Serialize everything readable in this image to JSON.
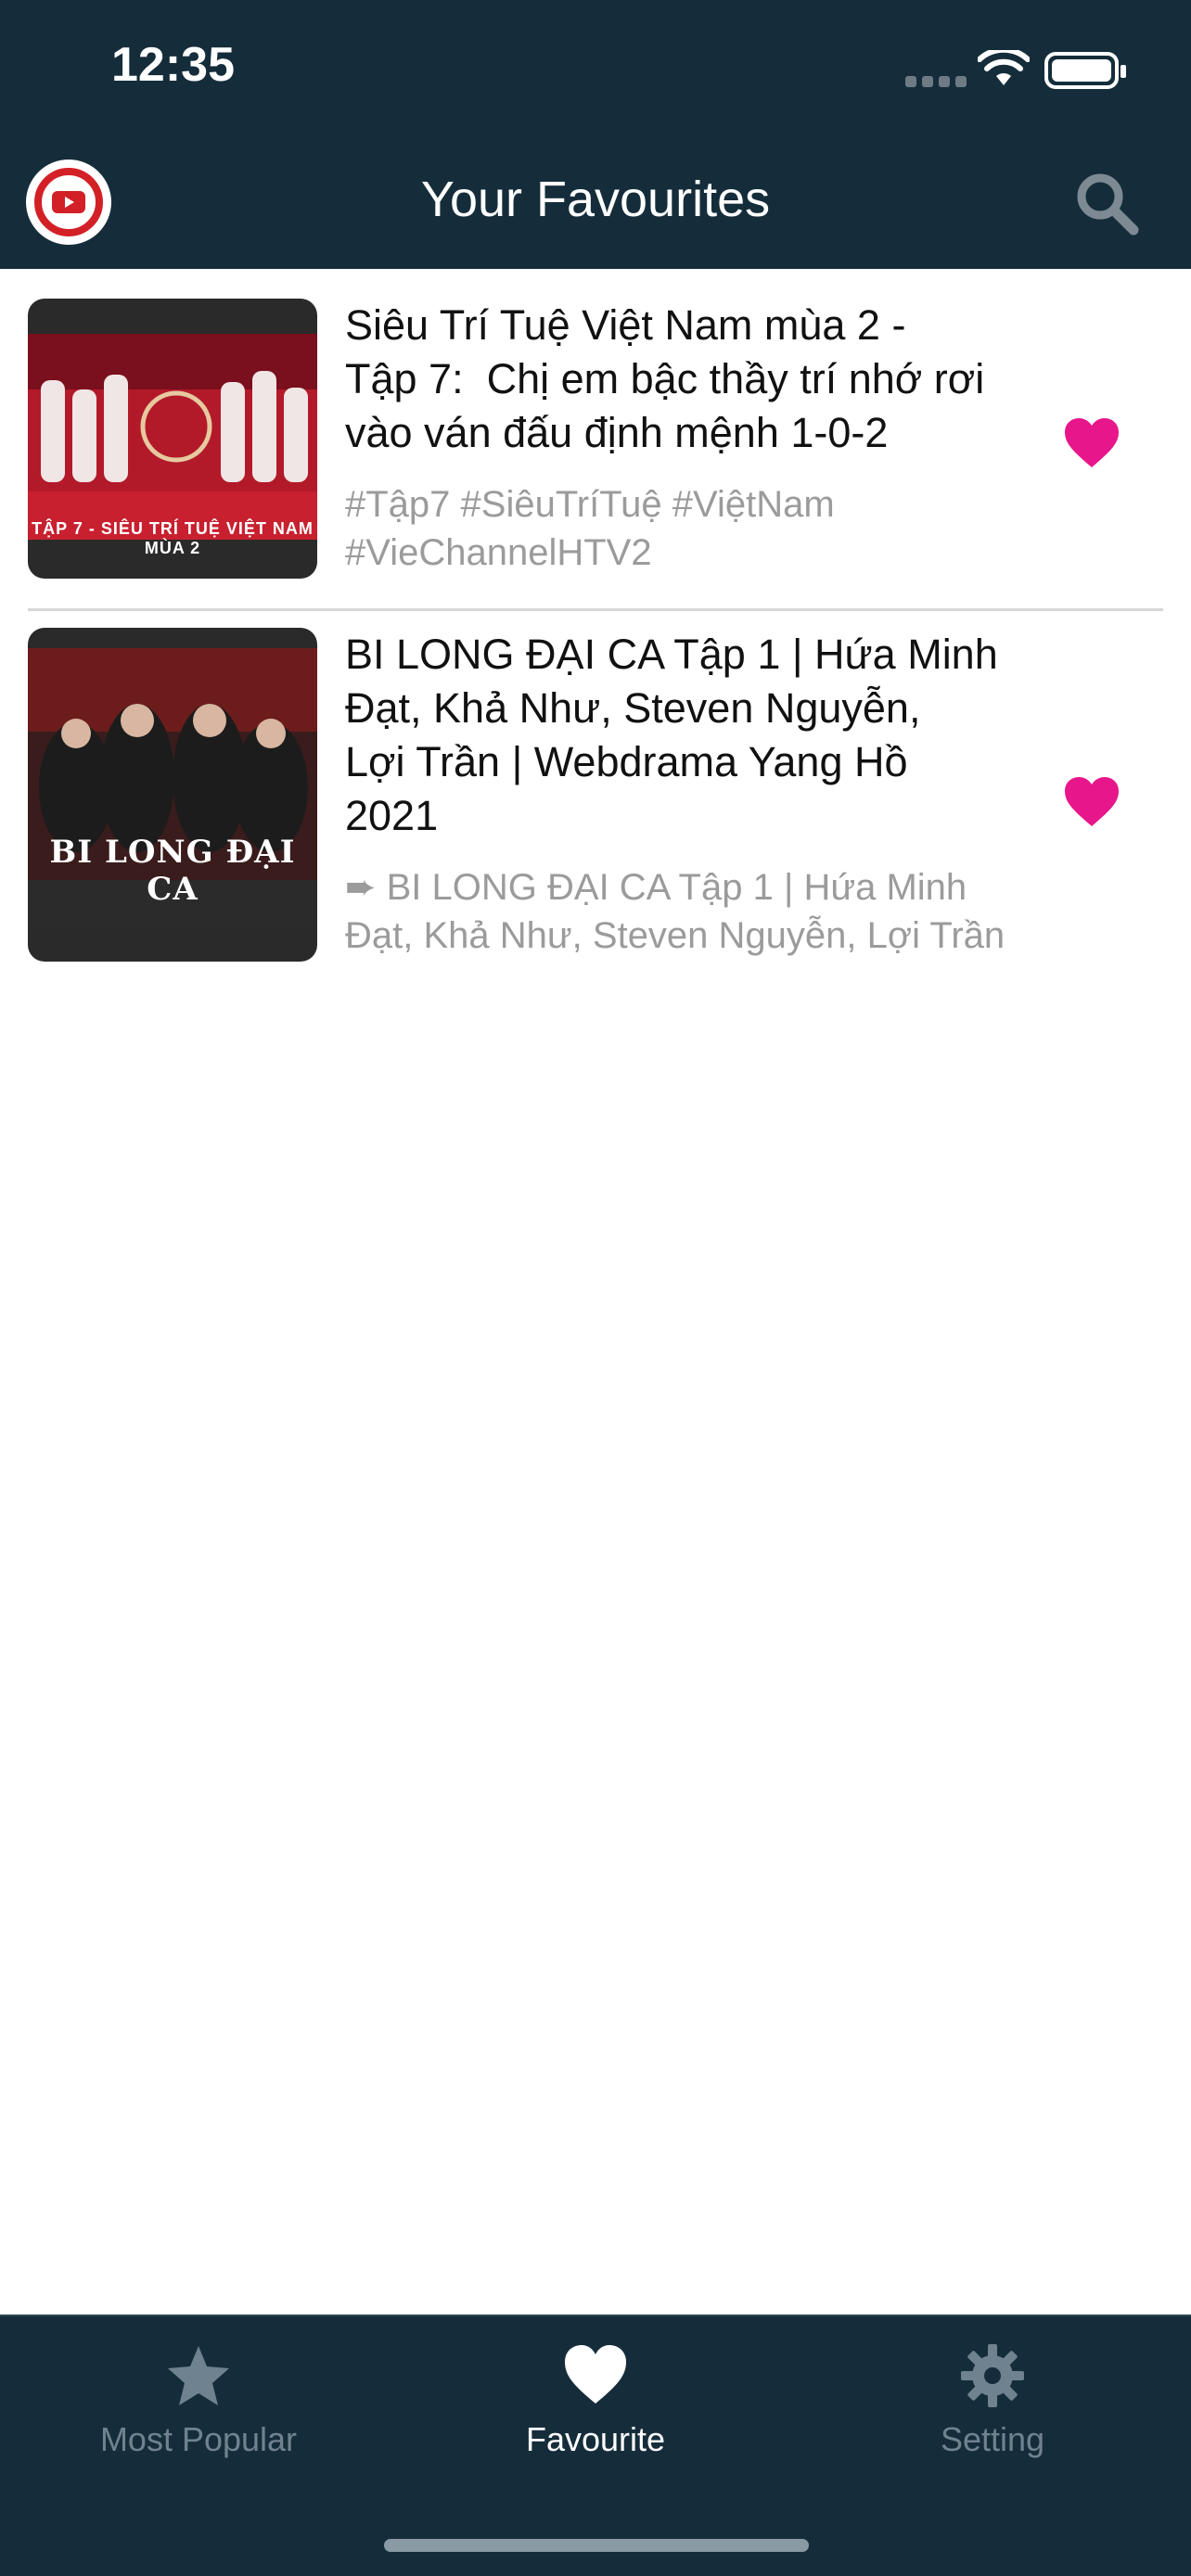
{
  "status": {
    "time": "12:35"
  },
  "header": {
    "title": "Your Favourites"
  },
  "colors": {
    "bar": "#152d3b",
    "accent": "#e8168b",
    "muted": "#9b9b9b"
  },
  "items": [
    {
      "title": "Siêu Trí Tuệ Việt Nam mùa 2 -\nTập 7:  Chị em bậc thầy trí nhớ rơi\nvào ván đấu định mệnh 1-0-2",
      "subtitle": "#Tập7 #SiêuTríTuệ #ViệtNam\n#VieChannelHTV2",
      "thumb_caption": "TẬP 7 - SIÊU TRÍ TUỆ VIỆT NAM MÙA 2",
      "icon": "heart-icon"
    },
    {
      "title": "BI LONG ĐẠI CA Tập 1 | Hứa Minh\nĐạt, Khả Như, Steven Nguyễn,\nLợi Trần | Webdrama Yang Hồ\n2021",
      "subtitle": "➨ BI LONG ĐẠI CA Tập 1 | Hứa Minh\nĐạt, Khả Như, Steven Nguyễn, Lợi Trần",
      "thumb_caption": "BI LONG ĐẠI CA",
      "icon": "heart-icon"
    }
  ],
  "tabs": [
    {
      "label": "Most Popular",
      "icon": "star-icon",
      "active": false
    },
    {
      "label": "Favourite",
      "icon": "heart-icon",
      "active": true
    },
    {
      "label": "Setting",
      "icon": "gear-icon",
      "active": false
    }
  ]
}
